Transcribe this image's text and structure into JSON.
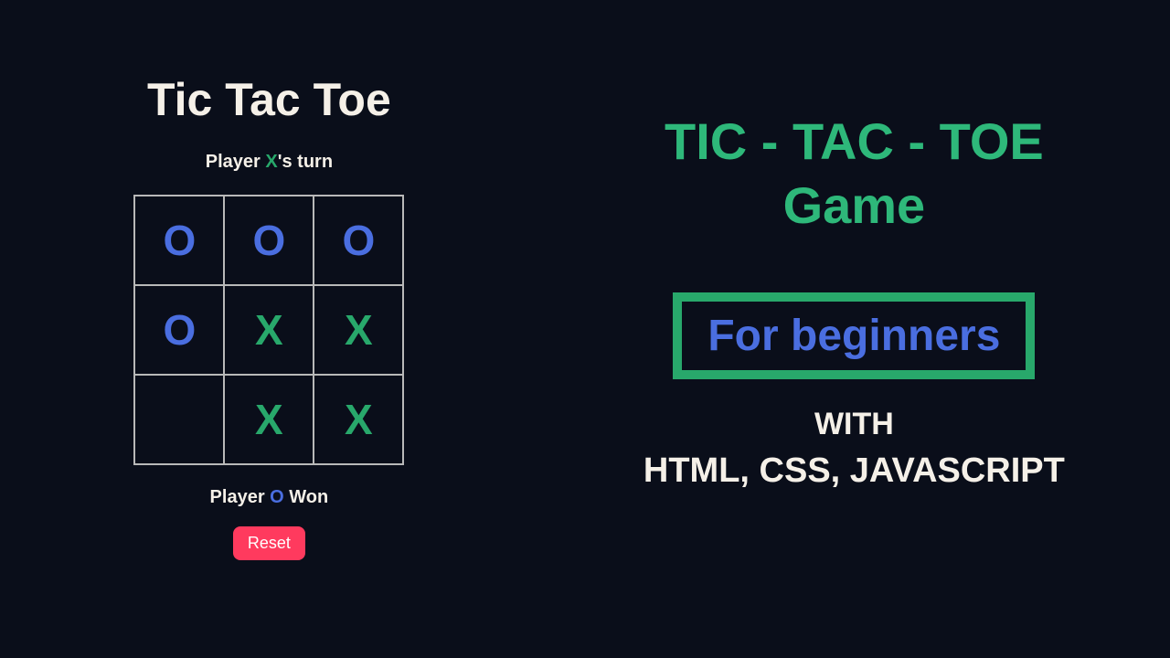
{
  "game": {
    "title": "Tic Tac Toe",
    "turn": {
      "prefix": "Player ",
      "player": "X",
      "suffix": "'s turn"
    },
    "board": [
      "O",
      "O",
      "O",
      "O",
      "X",
      "X",
      "",
      "X",
      "X"
    ],
    "status": {
      "prefix": "Player ",
      "player": "O",
      "suffix": " Won"
    },
    "reset_label": "Reset"
  },
  "promo": {
    "title_line1": "TIC - TAC - TOE",
    "title_line2": "Game",
    "badge": "For beginners",
    "with": "WITH",
    "tech": "HTML, CSS, JAVASCRIPT"
  },
  "colors": {
    "bg": "#0a0e1a",
    "x": "#28a86b",
    "o": "#4a6ee0",
    "accent_red": "#ff3a5e",
    "text": "#f5f0e8"
  }
}
